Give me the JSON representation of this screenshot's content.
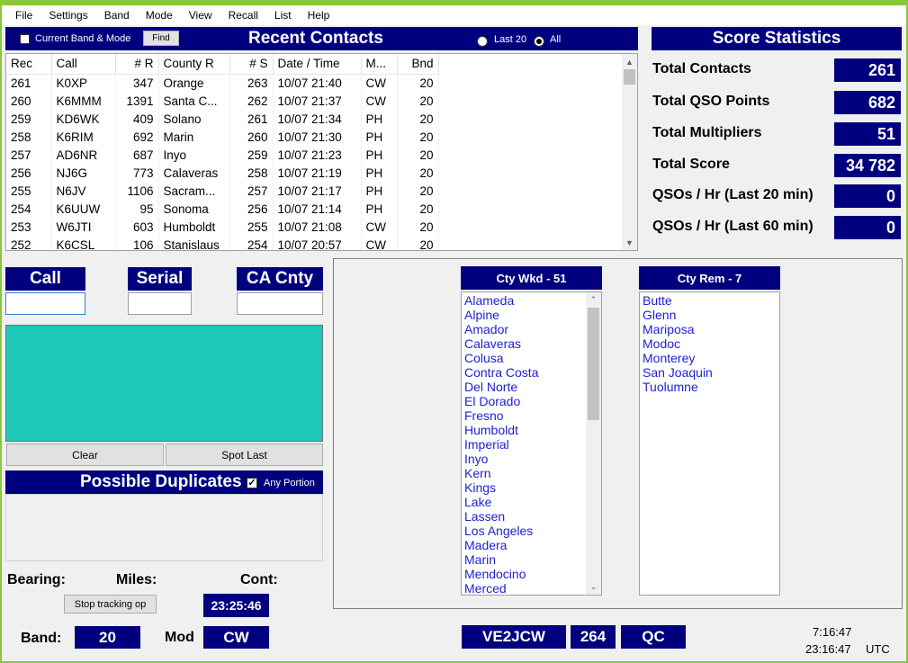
{
  "menu": [
    "File",
    "Settings",
    "Band",
    "Mode",
    "View",
    "Recall",
    "List",
    "Help"
  ],
  "recent": {
    "checkbox_label": "Current Band & Mode",
    "find_label": "Find",
    "title": "Recent Contacts",
    "radio_last20": "Last 20",
    "radio_all": "All",
    "columns": [
      "Rec",
      "Call",
      "# R",
      "County R",
      "# S",
      "Date / Time",
      "M...",
      "Bnd"
    ],
    "rows": [
      [
        "261",
        "K0XP",
        "347",
        "Orange",
        "263",
        "10/07  21:40",
        "CW",
        "20"
      ],
      [
        "260",
        "K6MMM",
        "1391",
        "Santa C...",
        "262",
        "10/07  21:37",
        "CW",
        "20"
      ],
      [
        "259",
        "KD6WK",
        "409",
        "Solano",
        "261",
        "10/07  21:34",
        "PH",
        "20"
      ],
      [
        "258",
        "K6RIM",
        "692",
        "Marin",
        "260",
        "10/07  21:30",
        "PH",
        "20"
      ],
      [
        "257",
        "AD6NR",
        "687",
        "Inyo",
        "259",
        "10/07  21:23",
        "PH",
        "20"
      ],
      [
        "256",
        "NJ6G",
        "773",
        "Calaveras",
        "258",
        "10/07  21:19",
        "PH",
        "20"
      ],
      [
        "255",
        "N6JV",
        "1106",
        "Sacram...",
        "257",
        "10/07  21:17",
        "PH",
        "20"
      ],
      [
        "254",
        "K6UUW",
        "95",
        "Sonoma",
        "256",
        "10/07  21:14",
        "PH",
        "20"
      ],
      [
        "253",
        "W6JTI",
        "603",
        "Humboldt",
        "255",
        "10/07  21:08",
        "CW",
        "20"
      ],
      [
        "252",
        "K6CSL",
        "106",
        "Stanislaus",
        "254",
        "10/07  20:57",
        "CW",
        "20"
      ]
    ]
  },
  "score": {
    "title": "Score Statistics",
    "items": [
      {
        "label": "Total Contacts",
        "value": "261"
      },
      {
        "label": "Total QSO Points",
        "value": "682"
      },
      {
        "label": "Total Multipliers",
        "value": "51"
      },
      {
        "label": "Total Score",
        "value": "34 782"
      },
      {
        "label": "QSOs / Hr (Last 20 min)",
        "value": "0"
      },
      {
        "label": "QSOs / Hr (Last 60 min)",
        "value": "0"
      }
    ]
  },
  "entry": {
    "call_label": "Call",
    "serial_label": "Serial",
    "cacnty_label": "CA Cnty",
    "call_value": "",
    "serial_value": "",
    "cacnty_value": ""
  },
  "buttons": {
    "clear": "Clear",
    "spot_last": "Spot Last",
    "stop_tracking": "Stop tracking op"
  },
  "dupes": {
    "title": "Possible Duplicates",
    "any_portion": "Any Portion"
  },
  "worked": {
    "title": "Cty Wkd - 51",
    "items": [
      "Alameda",
      "Alpine",
      "Amador",
      "Calaveras",
      "Colusa",
      "Contra Costa",
      "Del Norte",
      "El Dorado",
      "Fresno",
      "Humboldt",
      "Imperial",
      "Inyo",
      "Kern",
      "Kings",
      "Lake",
      "Lassen",
      "Los Angeles",
      "Madera",
      "Marin",
      "Mendocino",
      "Merced"
    ]
  },
  "remaining": {
    "title": "Cty Rem - 7",
    "items": [
      "Butte",
      "Glenn",
      "Mariposa",
      "Modoc",
      "Monterey",
      "San Joaquin",
      "Tuolumne"
    ]
  },
  "footer": {
    "bearing_label": "Bearing:",
    "miles_label": "Miles:",
    "cont_label": "Cont:",
    "time_display": "23:25:46",
    "band_label": "Band:",
    "band_value": "20",
    "mod_label": "Mod",
    "mod_value": "CW",
    "my_call": "VE2JCW",
    "next_serial": "264",
    "my_qth": "QC",
    "local_time": "7:16:47",
    "utc_time": "23:16:47",
    "utc_label": "UTC"
  },
  "colors": {
    "navy": "#00007f",
    "teal": "#1ec8b9",
    "green": "#8cc63f",
    "link": "#1e1ed2"
  }
}
